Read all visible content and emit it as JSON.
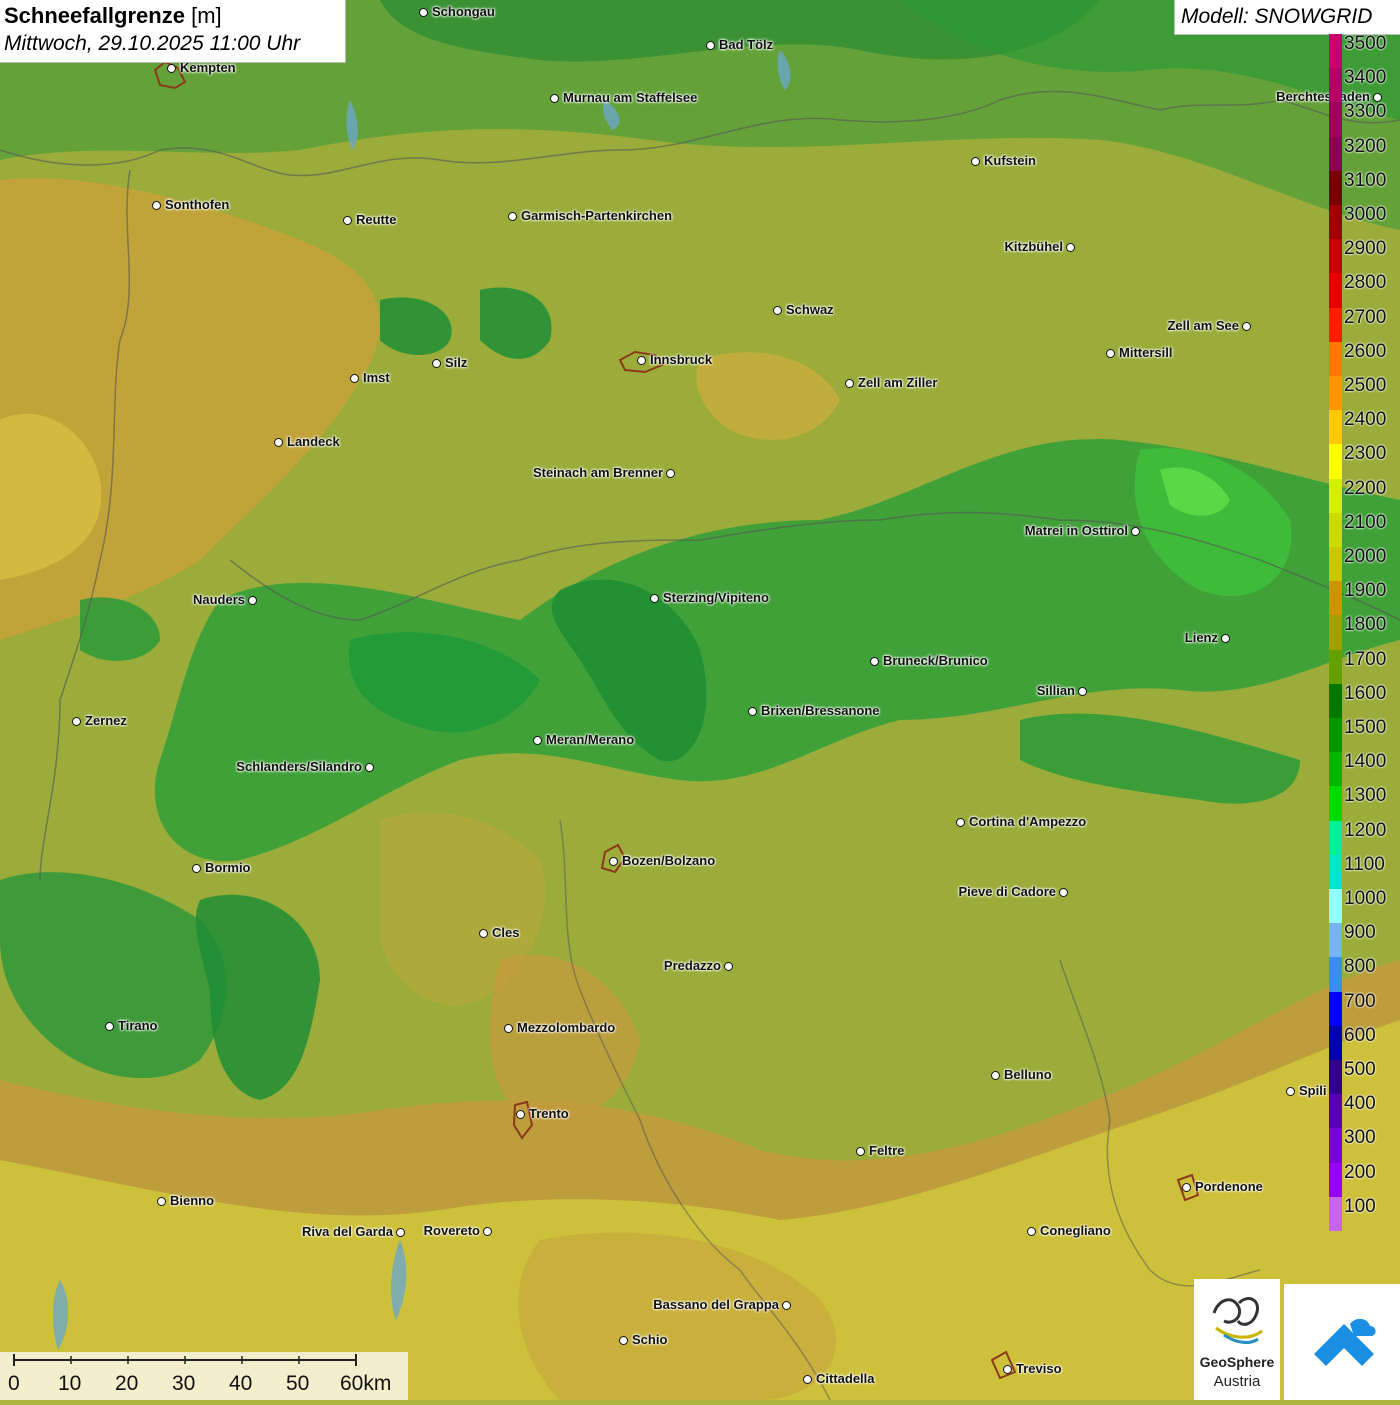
{
  "header": {
    "title_bold": "Schneefallgrenze",
    "title_unit": "[m]",
    "datetime": "Mittwoch, 29.10.2025 11:00 Uhr"
  },
  "model": {
    "label": "Modell: SNOWGRID"
  },
  "legend": {
    "levels": [
      {
        "value": "3500",
        "color": "#c8006e"
      },
      {
        "value": "3400",
        "color": "#b40064"
      },
      {
        "value": "3300",
        "color": "#a0005a"
      },
      {
        "value": "3200",
        "color": "#8c0050"
      },
      {
        "value": "3100",
        "color": "#780000"
      },
      {
        "value": "3000",
        "color": "#a00000"
      },
      {
        "value": "2900",
        "color": "#c80000"
      },
      {
        "value": "2800",
        "color": "#e60000"
      },
      {
        "value": "2700",
        "color": "#ff1e00"
      },
      {
        "value": "2600",
        "color": "#ff7800"
      },
      {
        "value": "2500",
        "color": "#ff9600"
      },
      {
        "value": "2400",
        "color": "#ffc800"
      },
      {
        "value": "2300",
        "color": "#ffff00"
      },
      {
        "value": "2200",
        "color": "#d2f000"
      },
      {
        "value": "2100",
        "color": "#c8dc00"
      },
      {
        "value": "2000",
        "color": "#c8c800"
      },
      {
        "value": "1900",
        "color": "#c89600"
      },
      {
        "value": "1800",
        "color": "#a0a000"
      },
      {
        "value": "1700",
        "color": "#64a000"
      },
      {
        "value": "1600",
        "color": "#007800"
      },
      {
        "value": "1500",
        "color": "#009600"
      },
      {
        "value": "1400",
        "color": "#00b400"
      },
      {
        "value": "1300",
        "color": "#00dc00"
      },
      {
        "value": "1200",
        "color": "#00f096"
      },
      {
        "value": "1100",
        "color": "#00e6c8"
      },
      {
        "value": "1000",
        "color": "#96ffff"
      },
      {
        "value": "900",
        "color": "#78b4f0"
      },
      {
        "value": "800",
        "color": "#3c8cf0"
      },
      {
        "value": "700",
        "color": "#0000ff"
      },
      {
        "value": "600",
        "color": "#0000b4"
      },
      {
        "value": "500",
        "color": "#32008c"
      },
      {
        "value": "400",
        "color": "#5a00b4"
      },
      {
        "value": "300",
        "color": "#7800dc"
      },
      {
        "value": "200",
        "color": "#9600ff"
      },
      {
        "value": "100",
        "color": "#c864f0"
      }
    ]
  },
  "scale": {
    "ticks": [
      "0",
      "10",
      "20",
      "30",
      "40",
      "50",
      "60km"
    ]
  },
  "cities": [
    {
      "name": "Schongau"
    },
    {
      "name": "Kempten"
    },
    {
      "name": "Bad Tölz"
    },
    {
      "name": "Murnau am Staffelsee"
    },
    {
      "name": "Berchtesgaden"
    },
    {
      "name": "Kufstein"
    },
    {
      "name": "Sonthofen"
    },
    {
      "name": "Reutte"
    },
    {
      "name": "Garmisch-Partenkirchen"
    },
    {
      "name": "Kitzbühel"
    },
    {
      "name": "Schwaz"
    },
    {
      "name": "Zell am See"
    },
    {
      "name": "Mittersill"
    },
    {
      "name": "Innsbruck"
    },
    {
      "name": "Silz"
    },
    {
      "name": "Imst"
    },
    {
      "name": "Zell am Ziller"
    },
    {
      "name": "Landeck"
    },
    {
      "name": "Steinach am Brenner"
    },
    {
      "name": "Matrei in Osttirol"
    },
    {
      "name": "Nauders"
    },
    {
      "name": "Sterzing/Vipiteno"
    },
    {
      "name": "Lienz"
    },
    {
      "name": "Bruneck/Brunico"
    },
    {
      "name": "Sillian"
    },
    {
      "name": "Zernez"
    },
    {
      "name": "Brixen/Bressanone"
    },
    {
      "name": "Meran/Merano"
    },
    {
      "name": "Schlanders/Silandro"
    },
    {
      "name": "Cortina d'Ampezzo"
    },
    {
      "name": "Bozen/Bolzano"
    },
    {
      "name": "Bormio"
    },
    {
      "name": "Pieve di Cadore"
    },
    {
      "name": "Cles"
    },
    {
      "name": "Predazzo"
    },
    {
      "name": "Tirano"
    },
    {
      "name": "Mezzolombardo"
    },
    {
      "name": "Belluno"
    },
    {
      "name": "Spili"
    },
    {
      "name": "Trento"
    },
    {
      "name": "Feltre"
    },
    {
      "name": "Pordenone"
    },
    {
      "name": "Bienno"
    },
    {
      "name": "Riva del Garda"
    },
    {
      "name": "Rovereto"
    },
    {
      "name": "Conegliano"
    },
    {
      "name": "Bassano del Grappa"
    },
    {
      "name": "Schio"
    },
    {
      "name": "Treviso"
    },
    {
      "name": "Cittadella"
    }
  ],
  "logos": {
    "geosphere_line1": "GeoSphere",
    "geosphere_line2": "Austria"
  }
}
